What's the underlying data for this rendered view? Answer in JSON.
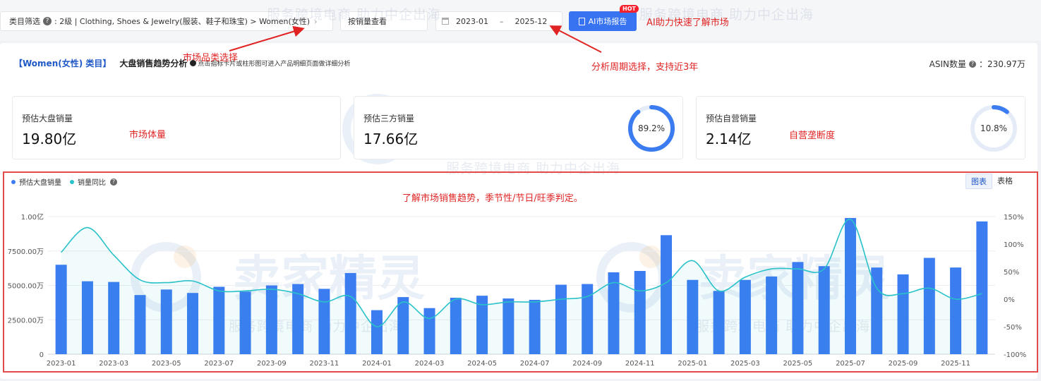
{
  "filters": {
    "category_label": "类目筛选",
    "category_path": ": 2级 | Clothing, Shoes & Jewelry(服装、鞋子和珠宝) > Women(女性)",
    "sales_view": "按销量查看",
    "date_start": "2023-01",
    "date_sep": "–",
    "date_end": "2025-12",
    "ai_button": "AI市场报告",
    "hot_badge": "HOT"
  },
  "header": {
    "category_tag": "【Women(女性) 类目】",
    "title": "大盘销售趋势分析",
    "tip": "点击指标卡片或柱形图可进入产品明细页面做详细分析",
    "asin_label": "ASIN数量",
    "asin_colon": "：",
    "asin_value": "230.97万"
  },
  "stats": [
    {
      "label": "预估大盘销量",
      "value": "19.80亿"
    },
    {
      "label": "预估三方销量",
      "value": "17.66亿",
      "ring_percent": 89.2,
      "ring_text": "89.2%"
    },
    {
      "label": "预估自营销量",
      "value": "2.14亿",
      "ring_percent": 10.8,
      "ring_text": "10.8%"
    }
  ],
  "legend": {
    "series1": "预估大盘销量",
    "series2": "销量同比"
  },
  "view_toggle": {
    "chart": "图表",
    "table": "表格"
  },
  "annotations": {
    "category_select": "市场品类选择",
    "ai_help": "AI助力快速了解市场",
    "period_select": "分析周期选择，支持近3年",
    "market_volume": "市场体量",
    "self_monopoly": "自营垄断度",
    "trend": "了解市场销售趋势，季节性/节日/旺季判定。"
  },
  "watermark": {
    "slogan": "服务跨境电商 助力中企出海",
    "brand": "卖家精灵"
  },
  "colors": {
    "bar": "#3b7cf0",
    "line": "#29c2c9",
    "accent": "#3874f2",
    "annotation": "#e02424"
  },
  "chart_data": {
    "type": "bar",
    "categories": [
      "2023-01",
      "2023-02",
      "2023-03",
      "2023-04",
      "2023-05",
      "2023-06",
      "2023-07",
      "2023-08",
      "2023-09",
      "2023-10",
      "2023-11",
      "2023-12",
      "2024-01",
      "2024-02",
      "2024-03",
      "2024-04",
      "2024-05",
      "2024-06",
      "2024-07",
      "2024-08",
      "2024-09",
      "2024-10",
      "2024-11",
      "2024-12",
      "2025-01",
      "2025-02",
      "2025-03",
      "2025-04",
      "2025-05",
      "2025-06",
      "2025-07",
      "2025-08",
      "2025-09",
      "2025-10",
      "2025-11",
      "2025-12"
    ],
    "x_tick_labels": [
      "2023-01",
      "2023-03",
      "2023-05",
      "2023-07",
      "2023-09",
      "2023-11",
      "2024-01",
      "2024-03",
      "2024-05",
      "2024-07",
      "2024-09",
      "2024-11",
      "2025-01",
      "2025-03",
      "2025-05",
      "2025-07",
      "2025-09",
      "2025-11"
    ],
    "series": [
      {
        "name": "预估大盘销量",
        "axis": "left",
        "values": [
          6500,
          5300,
          5250,
          4300,
          4700,
          4450,
          4900,
          4550,
          5000,
          5100,
          4750,
          5900,
          3200,
          4150,
          3350,
          4100,
          4250,
          4050,
          3950,
          5050,
          5100,
          5950,
          6050,
          8650,
          5400,
          4600,
          5400,
          5650,
          6700,
          6400,
          9900,
          6300,
          5800,
          7000,
          6300,
          9650
        ]
      },
      {
        "name": "销量同比",
        "axis": "right",
        "values": [
          85,
          130,
          80,
          35,
          30,
          33,
          15,
          15,
          18,
          10,
          -5,
          5,
          -50,
          -5,
          -35,
          0,
          -10,
          -5,
          -5,
          0,
          5,
          30,
          15,
          30,
          70,
          15,
          40,
          55,
          55,
          55,
          145,
          20,
          10,
          20,
          0,
          10
        ]
      }
    ],
    "y_left": {
      "min": 0,
      "max": 10000,
      "ticks": [
        0,
        2500,
        5000,
        7500,
        10000
      ],
      "tick_labels": [
        "0",
        "2500.00万",
        "5000.00万",
        "7500.00万",
        "1.00亿"
      ]
    },
    "y_right": {
      "min": -100,
      "max": 150,
      "ticks": [
        -100,
        -50,
        0,
        50,
        100,
        150
      ],
      "tick_labels": [
        "-100%",
        "-50%",
        "0%",
        "50%",
        "100%",
        "150%"
      ]
    },
    "grid": true,
    "legend_position": "top-left"
  }
}
